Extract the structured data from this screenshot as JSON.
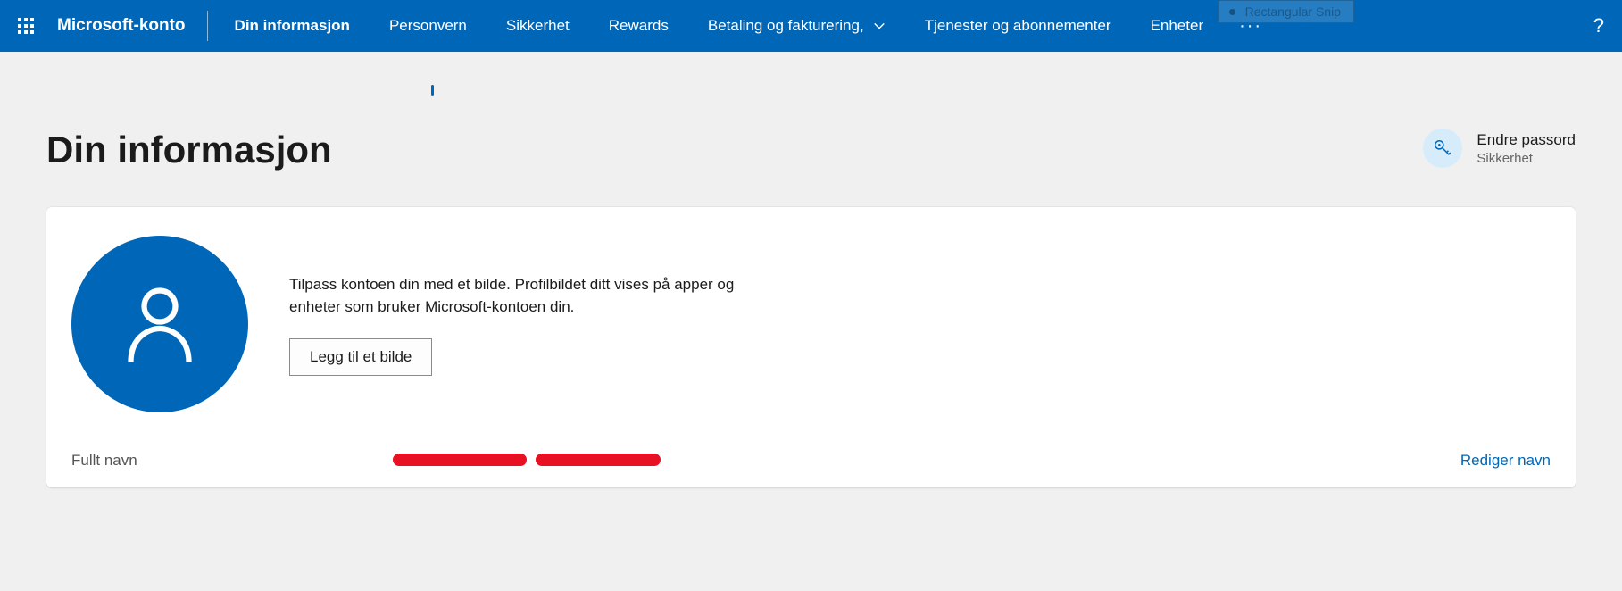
{
  "snip_label": "Rectangular Snip",
  "nav": {
    "brand": "Microsoft-konto",
    "items": [
      {
        "label": "Din informasjon",
        "active": true
      },
      {
        "label": "Personvern"
      },
      {
        "label": "Sikkerhet"
      },
      {
        "label": "Rewards"
      },
      {
        "label": "Betaling og fakturering,",
        "dropdown": true
      },
      {
        "label": "Tjenester og abonnementer"
      },
      {
        "label": "Enheter"
      }
    ],
    "more": "···",
    "help": "?"
  },
  "page": {
    "title": "Din informasjon",
    "quick_action": {
      "title": "Endre passord",
      "subtitle": "Sikkerhet"
    }
  },
  "profile": {
    "description": "Tilpass kontoen din med et bilde. Profilbildet ditt vises på apper og enheter som bruker Microsoft-kontoen din.",
    "add_photo_label": "Legg til et bilde"
  },
  "name_row": {
    "label": "Fullt navn",
    "edit_label": "Rediger navn"
  }
}
